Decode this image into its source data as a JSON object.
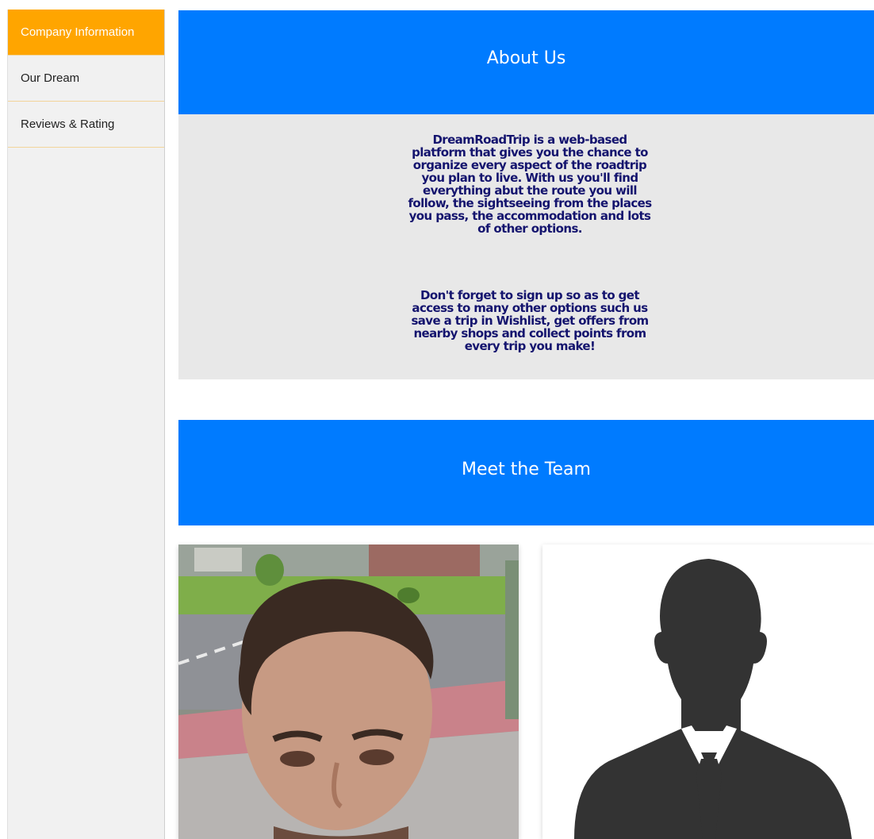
{
  "sidebar": {
    "items": [
      {
        "label": "Company Information",
        "active": true
      },
      {
        "label": "Our Dream",
        "active": false
      },
      {
        "label": "Reviews & Rating",
        "active": false
      }
    ]
  },
  "about": {
    "heading": "About Us",
    "paragraph_1_lines": [
      "DreamRoadTrip is a web-based",
      "platform that gives you the chance to",
      "organize every aspect of the roadtrip",
      "you plan to live. With us you'll find",
      "everything abut the route you will",
      "follow, the sightseeing from the places",
      "you pass, the accommodation and lots",
      "of other options."
    ],
    "paragraph_2_lines": [
      "Don't forget to sign up so as to get",
      "access to many other options such us",
      "save a trip in Wishlist, get offers from",
      "nearby shops and collect points from",
      "every trip you make!"
    ]
  },
  "team": {
    "heading": "Meet the Team",
    "members": [
      {
        "image": "member-photo"
      },
      {
        "image": "avatar-silhouette-placeholder"
      }
    ]
  },
  "colors": {
    "accent_orange": "#ffa500",
    "banner_blue": "#007bff",
    "about_text": "#14146e",
    "about_bg": "#e8e8e8"
  }
}
